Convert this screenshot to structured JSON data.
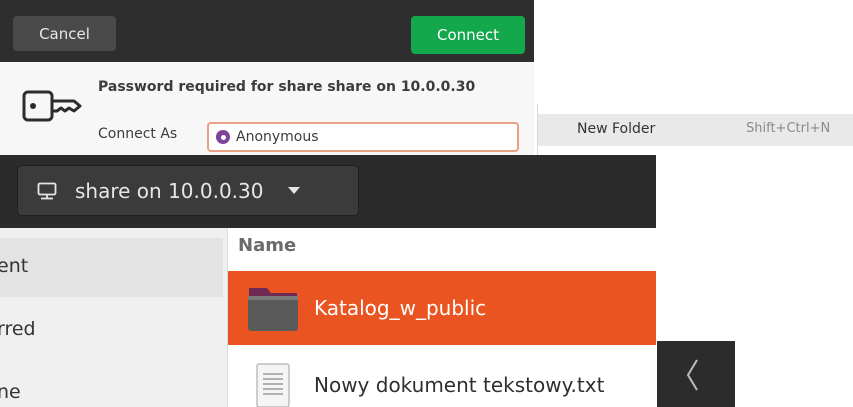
{
  "dialog": {
    "cancel_label": "Cancel",
    "connect_label": "Connect",
    "title": "Password required for share share on 10.0.0.30",
    "connect_as_label": "Connect As",
    "connect_as_option": "Anonymous",
    "icon": "key-icon"
  },
  "context_menu": {
    "item_label": "New Folder",
    "item_shortcut": "Shift+Ctrl+N"
  },
  "file_manager": {
    "location_label": "share on 10.0.0.30",
    "sidebar": {
      "items": [
        {
          "label": "ent"
        },
        {
          "label": "rred"
        },
        {
          "label": "ne"
        }
      ]
    },
    "list": {
      "column_header": "Name",
      "rows": [
        {
          "label": "Katalog_w_public",
          "icon": "folder-icon",
          "selected": true
        },
        {
          "label": "Nowy dokument tekstowy.txt",
          "icon": "text-file-icon",
          "selected": false
        }
      ]
    }
  },
  "colors": {
    "connect": "#13a84b",
    "selection": "#e95420",
    "radio": "#7e4497",
    "header_dark": "#2b2b2b"
  }
}
